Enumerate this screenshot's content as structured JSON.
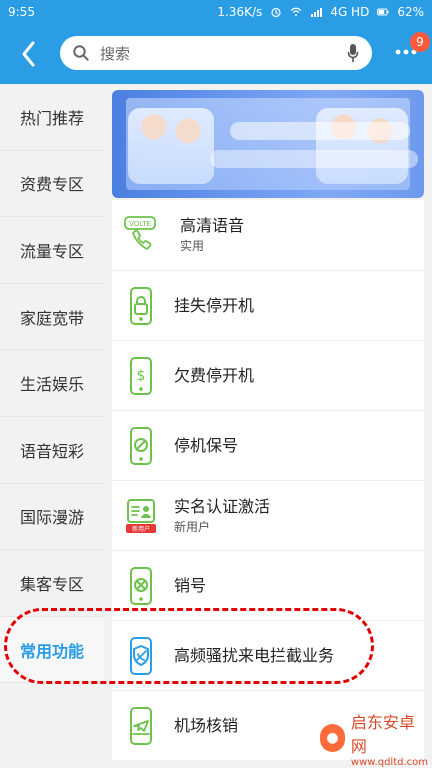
{
  "status_bar": {
    "time": "9:55",
    "speed": "1.36K/s",
    "network": "4G HD",
    "battery": "62%"
  },
  "top_bar": {
    "search_placeholder": "搜索",
    "notification_count": "9",
    "colors": {
      "primary": "#2a9de5",
      "badge": "#ff5a3c"
    }
  },
  "sidebar": {
    "items": [
      {
        "label": "热门推荐"
      },
      {
        "label": "资费专区"
      },
      {
        "label": "流量专区"
      },
      {
        "label": "家庭宽带"
      },
      {
        "label": "生活娱乐"
      },
      {
        "label": "语音短彩"
      },
      {
        "label": "国际漫游"
      },
      {
        "label": "集客专区"
      },
      {
        "label": "常用功能"
      }
    ],
    "active_index": 8
  },
  "banner": {},
  "list": {
    "items": [
      {
        "title": "高清语音",
        "subtitle": "实用",
        "icon": "volte-phone-icon",
        "icon_badge": "VOLTE"
      },
      {
        "title": "挂失停开机",
        "subtitle": "",
        "icon": "phone-lock-icon"
      },
      {
        "title": "欠费停开机",
        "subtitle": "",
        "icon": "phone-dollar-icon"
      },
      {
        "title": "停机保号",
        "subtitle": "",
        "icon": "phone-no-icon"
      },
      {
        "title": "实名认证激活",
        "subtitle": "新用户",
        "icon": "id-card-icon",
        "icon_badge": "新用户"
      },
      {
        "title": "销号",
        "subtitle": "",
        "icon": "phone-x-icon"
      },
      {
        "title": "高频骚扰来电拦截业务",
        "subtitle": "",
        "icon": "phone-shield-icon"
      },
      {
        "title": "机场核销",
        "subtitle": "",
        "icon": "phone-plane-icon"
      }
    ],
    "highlight_color": "#e10000",
    "icon_green": "#6cc24a",
    "icon_blue": "#2a9de5"
  },
  "watermark": {
    "line1": "启东安卓网",
    "line2": "www.qdltd.com"
  }
}
